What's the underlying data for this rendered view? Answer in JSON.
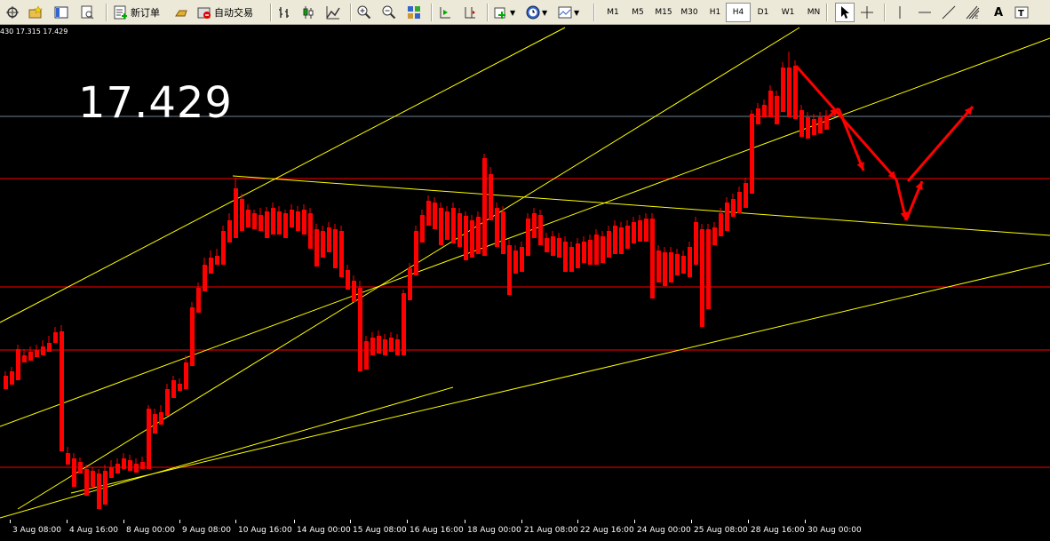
{
  "toolbar": {
    "new_order_label": "新订单",
    "auto_trade_label": "自动交易",
    "timeframes": [
      "M1",
      "M5",
      "M15",
      "M30",
      "H1",
      "H4",
      "D1",
      "W1",
      "MN"
    ],
    "active_timeframe": "H4"
  },
  "chart": {
    "ohlc_text": "430 17.315 17.429",
    "price_display": "17.429",
    "colors": {
      "bull": "#00ff00",
      "bear": "#ff0000",
      "trendline": "#ffff00",
      "hline": "#ff0000",
      "arrow": "#ff0000",
      "price_line": "#708090"
    }
  },
  "x_axis": {
    "labels": [
      "3 Aug 08:00",
      "4 Aug 16:00",
      "8 Aug 00:00",
      "9 Aug 08:00",
      "10 Aug 16:00",
      "14 Aug 00:00",
      "15 Aug 08:00",
      "16 Aug 16:00",
      "18 Aug 00:00",
      "21 Aug 08:00",
      "22 Aug 16:00",
      "24 Aug 00:00",
      "25 Aug 08:00",
      "28 Aug 16:00",
      "30 Aug 00:00"
    ]
  }
}
